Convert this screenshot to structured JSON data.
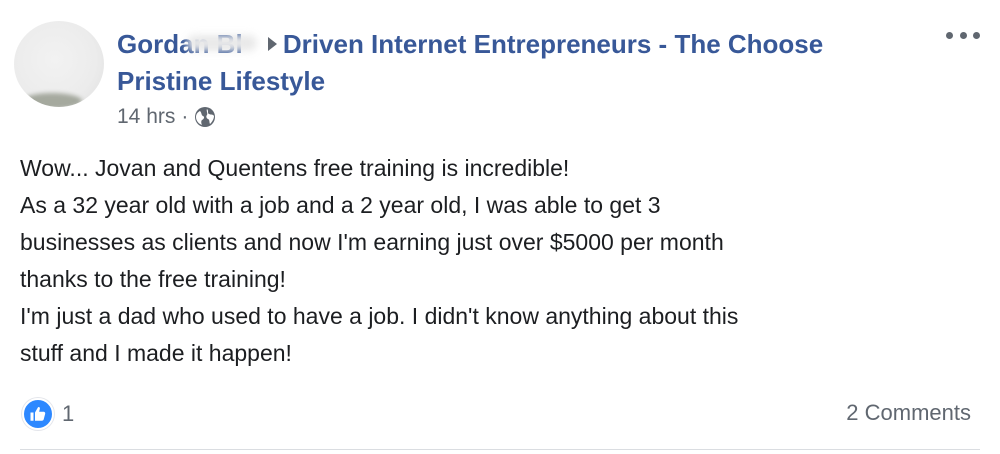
{
  "post": {
    "author_name": "Gordan Bl",
    "group_name": "Driven Internet Entrepreneurs - The Choose Pristine Lifestyle",
    "timestamp": "14 hrs",
    "separator": "·",
    "privacy_icon": "globe-icon",
    "menu_icon": "more-options-icon",
    "body_lines": [
      "Wow... Jovan and Quentens free training is incredible!",
      "As a 32 year old with a job and a 2 year old, I was able to get 3",
      "businesses as clients and now I'm earning just over $5000 per month",
      "thanks to the free training!",
      "I'm just a dad who used to have a job. I didn't know anything about this",
      "stuff and I made it happen!"
    ],
    "reactions": {
      "icon": "like-icon",
      "count": "1"
    },
    "comments_label": "2 Comments"
  },
  "colors": {
    "link_blue": "#385898",
    "meta_gray": "#606770",
    "like_blue": "#2d88ff",
    "text": "#1c1e21"
  }
}
